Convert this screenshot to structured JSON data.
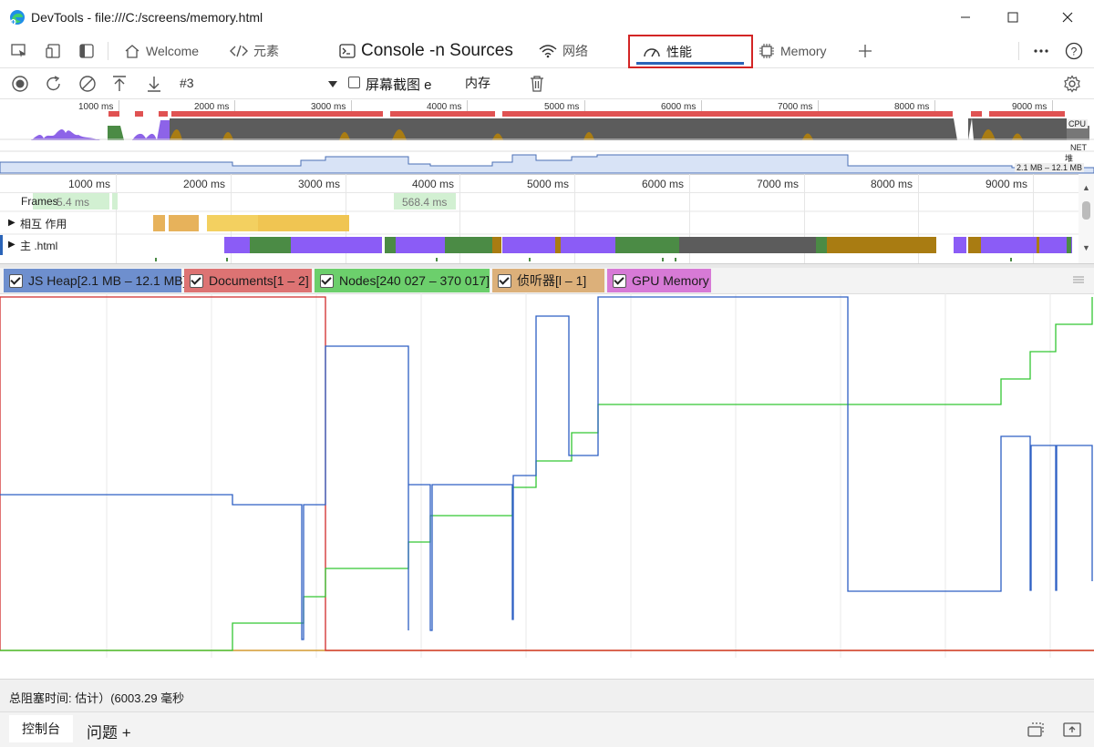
{
  "window": {
    "title": "DevTools - file:///C:/screens/memory.html"
  },
  "tabs": {
    "welcome": "Welcome",
    "elements": "元素",
    "console_sources": "Console -n Sources",
    "network": "网络",
    "performance": "性能",
    "memory": "Memory"
  },
  "toolbar": {
    "recording": "#3",
    "screenshots_label": "屏幕截图 e",
    "memory_label": "内存"
  },
  "overview": {
    "ticks": [
      "1000 ms",
      "2000 ms",
      "3000 ms",
      "4000 ms",
      "5000 ms",
      "6000 ms",
      "7000 ms",
      "8000 ms",
      "9000 ms"
    ],
    "cpu_label": "CPU",
    "net_label": "NET",
    "heap_label": "堆",
    "heap_range": "2.1 MB – 12.1 MB"
  },
  "timeline": {
    "ticks": [
      "1000 ms",
      "2000 ms",
      "3000 ms",
      "4000 ms",
      "5000 ms",
      "6000 ms",
      "7000 ms",
      "8000 ms",
      "9000 ms"
    ],
    "frames_label": "Frames",
    "frame_times": [
      "5.4 ms",
      "568.4 ms"
    ],
    "interactions_label": "相互 作用",
    "main_label": "主 .html"
  },
  "legend": [
    {
      "label": "JS Heap[2.1 MB – 12.1 MB]",
      "color": "#6e8fce",
      "checked": true
    },
    {
      "label": "Documents[1 – 2]",
      "color": "#dd7373",
      "checked": true
    },
    {
      "label": "Nodes[240 027 – 370 017]",
      "color": "#6ccf6c",
      "checked": true
    },
    {
      "label": "侦听器[l – 1]",
      "color": "#dcb07a",
      "checked": true
    },
    {
      "label": "GPU Memory",
      "color": "#d77ad6",
      "checked": true
    }
  ],
  "status": {
    "text": "总阻塞时间: 估计）(6003.29 毫秒"
  },
  "drawer": {
    "console_tab": "控制台",
    "issues_tab": "问题 +"
  },
  "colors": {
    "js_heap": "#2d5fc4",
    "documents": "#d12a2a",
    "nodes": "#33c633",
    "listeners": "#d49a30",
    "accent": "#2a64b8"
  }
}
